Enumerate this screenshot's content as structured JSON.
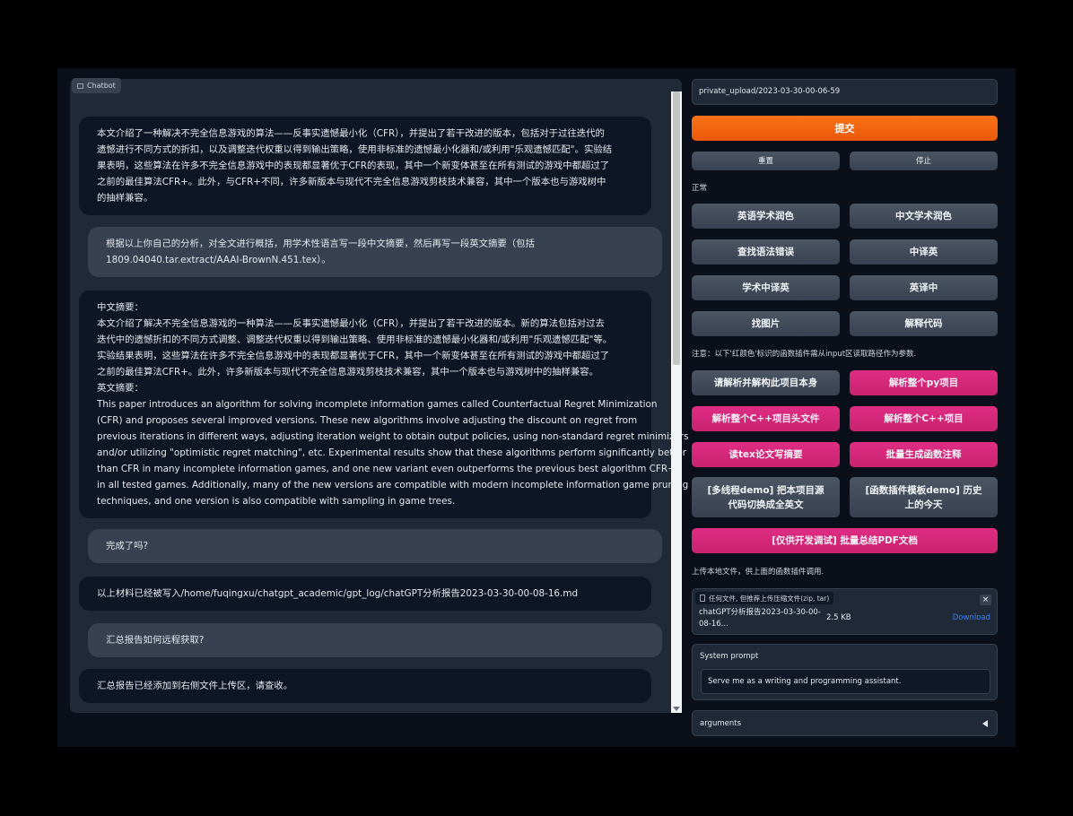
{
  "chatbot": {
    "label": "Chatbot",
    "messages": [
      {
        "role": "bot",
        "lines": [
          "本文介绍了一种解决不完全信息游戏的算法——反事实遗憾最小化（CFR），并提出了若干改进的版本，包括对于过往迭代的",
          "遗憾进行不同方式的折扣，以及调整迭代权重以得到输出策略，使用非标准的遗憾最小化器和/或利用\"乐观遗憾匹配\"。实验结",
          "果表明，这些算法在许多不完全信息游戏中的表现都显著优于CFR的表现，其中一个新变体甚至在所有测试的游戏中都超过了",
          "之前的最佳算法CFR+。此外，与CFR+不同，许多新版本与现代不完全信息游戏剪枝技术兼容，其中一个版本也与游戏树中",
          "的抽样兼容。"
        ]
      },
      {
        "role": "user",
        "lines": [
          "根据以上你自己的分析，对全文进行概括，用学术性语言写一段中文摘要，然后再写一段英文摘要（包括",
          "1809.04040.tar.extract/AAAI-BrownN.451.tex）。"
        ]
      },
      {
        "role": "bot",
        "lines": [
          "中文摘要：",
          "本文介绍了解决不完全信息游戏的一种算法——反事实遗憾最小化（CFR），并提出了若干改进的版本。新的算法包括对过去",
          "迭代中的遗憾折扣的不同方式调整、调整迭代权重以得到输出策略、使用非标准的遗憾最小化器和/或利用\"乐观遗憾匹配\"等。",
          "实验结果表明，这些算法在许多不完全信息游戏中的表现都显著优于CFR，其中一个新变体甚至在所有测试的游戏中都超过了",
          "之前的最佳算法CFR+。此外，许多新版本与现代不完全信息游戏剪枝技术兼容，其中一个版本也与游戏树中的抽样兼容。",
          "英文摘要：",
          "This paper introduces an algorithm for solving incomplete information games called Counterfactual Regret Minimization",
          "(CFR) and proposes several improved versions. These new algorithms involve adjusting the discount on regret from",
          "previous iterations in different ways, adjusting iteration weight to obtain output policies, using non-standard regret minimizers",
          "and/or utilizing \"optimistic regret matching\", etc. Experimental results show that these algorithms perform significantly better",
          "than CFR in many incomplete information games, and one new variant even outperforms the previous best algorithm CFR+",
          "in all tested games. Additionally, many of the new versions are compatible with modern incomplete information game pruning",
          "techniques, and one version is also compatible with sampling in game trees."
        ]
      },
      {
        "role": "user",
        "lines": [
          "完成了吗?"
        ]
      },
      {
        "role": "bot",
        "lines": [
          "以上材料已经被写入/home/fuqingxu/chatgpt_academic/gpt_log/chatGPT分析报告2023-03-30-00-08-16.md"
        ]
      },
      {
        "role": "user",
        "lines": [
          "汇总报告如何远程获取?"
        ]
      },
      {
        "role": "bot",
        "lines": [
          "汇总报告已经添加到右侧文件上传区，请查收。"
        ]
      }
    ]
  },
  "input": {
    "value": "private_upload/2023-03-30-00-06-59"
  },
  "buttons": {
    "submit": "提交",
    "reset": "重置",
    "stop": "停止"
  },
  "section_common": "正常",
  "common_buttons": [
    "英语学术润色",
    "中文学术润色",
    "查找语法错误",
    "中译英",
    "学术中译英",
    "英译中",
    "找图片",
    "解释代码"
  ],
  "plugin_note": "注意：以下'红颜色'标识的函数插件需从input区读取路径作为参数.",
  "plugin_buttons": [
    {
      "label": "请解析并解构此项目本身",
      "color": "gray"
    },
    {
      "label": "解析整个py项目",
      "color": "pink"
    },
    {
      "label": "解析整个C++项目头文件",
      "color": "pink"
    },
    {
      "label": "解析整个C++项目",
      "color": "pink"
    },
    {
      "label": "读tex论文写摘要",
      "color": "pink"
    },
    {
      "label": "批量生成函数注释",
      "color": "pink"
    },
    {
      "label": "[多线程demo] 把本项目源代码切换成全英文",
      "color": "gray"
    },
    {
      "label": "[函数插件模板demo] 历史上的今天",
      "color": "gray"
    },
    {
      "label": "[仅供开发调试] 批量总结PDF文档",
      "color": "pink"
    }
  ],
  "upload": {
    "note": "上传本地文件，供上面的函数插件调用.",
    "hint": "任何文件, 但推荐上传压缩文件(zip, tar)",
    "close": "×",
    "file_name": "chatGPT分析报告2023-03-30-00-08-16...",
    "file_size": "2.5 KB",
    "download": "Download"
  },
  "system_prompt": {
    "label": "System prompt",
    "value": "Serve me as a writing and programming assistant."
  },
  "arguments": {
    "label": "arguments"
  }
}
